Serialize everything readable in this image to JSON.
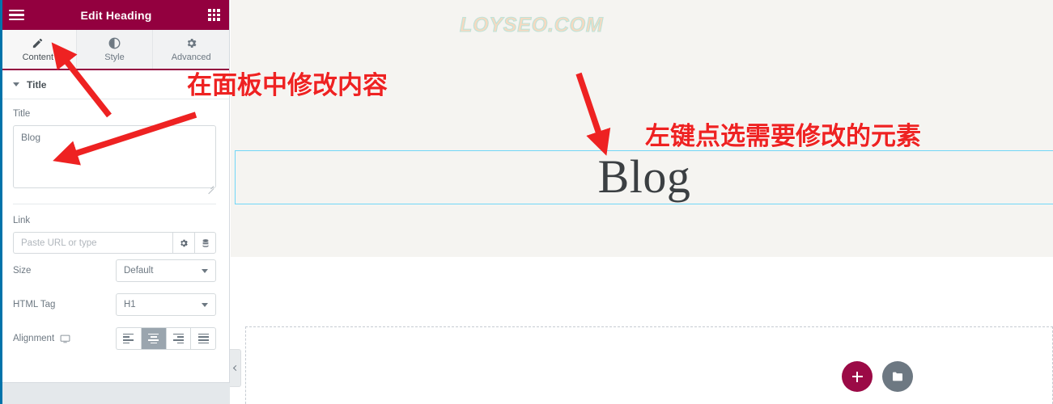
{
  "panel": {
    "header": {
      "title": "Edit Heading",
      "menu_icon": "hamburger-icon",
      "widgets_icon": "grid-icon"
    },
    "tabs": [
      {
        "label": "Content",
        "icon": "pencil-icon",
        "active": true
      },
      {
        "label": "Style",
        "icon": "contrast-icon",
        "active": false
      },
      {
        "label": "Advanced",
        "icon": "gear-icon",
        "active": false
      }
    ],
    "section": {
      "label": "Title",
      "expanded": true
    },
    "controls": {
      "title_label": "Title",
      "title_value": "Blog",
      "link_label": "Link",
      "link_value": "",
      "link_placeholder": "Paste URL or type",
      "link_options_icon": "gear-icon",
      "link_dynamic_icon": "dynamic-tags-icon",
      "size_label": "Size",
      "size_value": "Default",
      "html_tag_label": "HTML Tag",
      "html_tag_value": "H1",
      "alignment_label": "Alignment",
      "alignment_device_icon": "desktop-icon",
      "alignment_options": [
        "left",
        "center",
        "right",
        "justify"
      ],
      "alignment_selected": "center"
    },
    "collapse_handle_icon": "chevron-left-icon"
  },
  "canvas": {
    "watermark": "LOYSEO.COM",
    "heading": "Blog",
    "add_button_icon": "plus-icon",
    "folder_button_icon": "folder-icon"
  },
  "annotations": {
    "panel_note": "在面板中修改内容",
    "canvas_note": "左键点选需要修改的元素"
  },
  "colors": {
    "brand": "#93003f",
    "accent": "#9b0a46",
    "selection": "#71d7f7",
    "annotation": "#ee2222",
    "admin_bar": "#0073aa"
  }
}
